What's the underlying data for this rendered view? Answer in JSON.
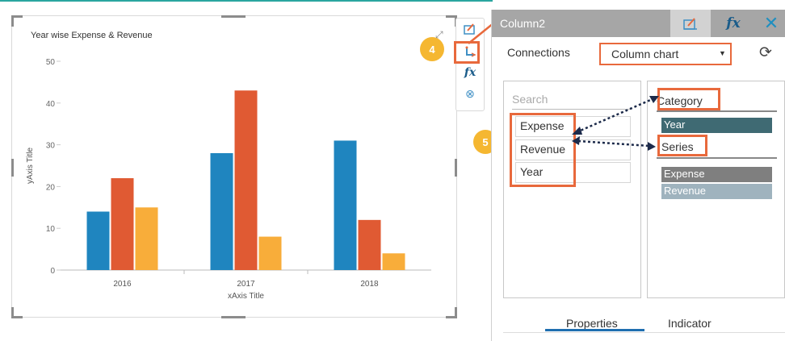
{
  "chart": {
    "title": "Year wise Expense & Revenue",
    "xlabel": "xAxis Title",
    "ylabel": "yAxis Title"
  },
  "chart_data": {
    "type": "bar",
    "title": "Year wise Expense & Revenue",
    "xlabel": "xAxis Title",
    "ylabel": "yAxis Title",
    "categories": [
      "2016",
      "2017",
      "2018"
    ],
    "series": [
      {
        "values": [
          14,
          28,
          31
        ],
        "color": "#1f85bf"
      },
      {
        "values": [
          22,
          43,
          12
        ],
        "color": "#e05a33"
      },
      {
        "values": [
          15,
          8,
          4
        ],
        "color": "#f8ad3a"
      }
    ],
    "ylim": [
      0,
      50
    ],
    "yticks": [
      0,
      10,
      20,
      30,
      40,
      50
    ],
    "grid": false,
    "legend": "none"
  },
  "callouts": {
    "step4": "4",
    "step5": "5"
  },
  "panel": {
    "title": "Column2",
    "connections_label": "Connections",
    "chart_type_value": "Column chart",
    "search_placeholder": "Search",
    "fields": [
      "Expense",
      "Revenue",
      "Year"
    ],
    "category_label": "Category",
    "category_items": [
      "Year"
    ],
    "series_label": "Series",
    "series_items": [
      "Expense",
      "Revenue"
    ],
    "tabs": [
      "Properties",
      "Indicator"
    ]
  },
  "colors": {
    "accent": "#e8693c",
    "callout": "#f5b731",
    "header": "#a6a6a6",
    "category_pill": "#3f6a73",
    "series_pill_1": "#7f7f7f",
    "series_pill_2": "#9fb3be",
    "tab_underline": "#1f6fb0"
  }
}
